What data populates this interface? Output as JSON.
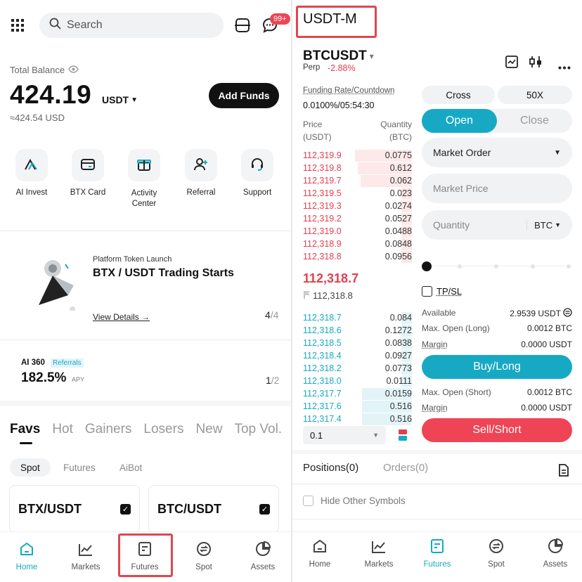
{
  "home": {
    "search": {
      "placeholder": "Search"
    },
    "notif_badge": "99+",
    "balance": {
      "label": "Total Balance",
      "value": "424.19",
      "currency": "USDT",
      "usd": "≈424.54 USD",
      "add_funds": "Add Funds"
    },
    "quick_actions": [
      {
        "label": "AI Invest",
        "icon": "ai-invest-icon"
      },
      {
        "label": "BTX Card",
        "icon": "card-icon"
      },
      {
        "label": "Activity Center",
        "icon": "gift-icon"
      },
      {
        "label": "Referral",
        "icon": "add-user-icon"
      },
      {
        "label": "Support",
        "icon": "headset-icon"
      }
    ],
    "promo": {
      "small": "Platform Token Launch",
      "title": "BTX / USDT Trading Starts",
      "link": "View Details →",
      "page": "4",
      "page_total": "/4"
    },
    "ai360": {
      "label": "AI 360",
      "badge": "Referrals",
      "value": "182.5%",
      "apy": "APY",
      "page": "1",
      "page_total": "/2"
    },
    "tabs": [
      "Favs",
      "Hot",
      "Gainers",
      "Losers",
      "New",
      "Top Vol."
    ],
    "subtabs": [
      "Spot",
      "Futures",
      "AiBot"
    ],
    "pairs": [
      "BTX/USDT",
      "BTC/USDT"
    ],
    "nav": [
      "Home",
      "Markets",
      "Futures",
      "Spot",
      "Assets"
    ]
  },
  "futures": {
    "market_type": "USDT-M",
    "symbol": "BTCUSDT",
    "symbol_arrow": "▾",
    "perp": "Perp",
    "change": "-2.88%",
    "funding_label": "Funding Rate/Countdown",
    "funding_value": "0.0100%/05:54:30",
    "orderbook": {
      "price_header": "Price",
      "price_unit": "(USDT)",
      "qty_header": "Quantity",
      "qty_unit": "(BTC)",
      "asks": [
        {
          "price": "112,319.9",
          "qty": "0.0775",
          "depth": 0.52
        },
        {
          "price": "112,319.8",
          "qty": "0.612",
          "depth": 0.5
        },
        {
          "price": "112,319.7",
          "qty": "0.062",
          "depth": 0.47
        },
        {
          "price": "112,319.5",
          "qty": "0.023",
          "depth": 0.1
        },
        {
          "price": "112,319.3",
          "qty": "0.0274",
          "depth": 0.1
        },
        {
          "price": "112,319.2",
          "qty": "0.0527",
          "depth": 0.1
        },
        {
          "price": "112,319.0",
          "qty": "0.0488",
          "depth": 0.1
        },
        {
          "price": "112,318.9",
          "qty": "0.0848",
          "depth": 0.1
        },
        {
          "price": "112,318.8",
          "qty": "0.0956",
          "depth": 0.1
        }
      ],
      "last_price": "112,318.7",
      "mark_price": "112,318.8",
      "bids": [
        {
          "price": "112,318.7",
          "qty": "0.084",
          "depth": 0.1
        },
        {
          "price": "112,318.6",
          "qty": "0.1272",
          "depth": 0.1
        },
        {
          "price": "112,318.5",
          "qty": "0.0838",
          "depth": 0.1
        },
        {
          "price": "112,318.4",
          "qty": "0.0927",
          "depth": 0.1
        },
        {
          "price": "112,318.2",
          "qty": "0.0773",
          "depth": 0.1
        },
        {
          "price": "112,318.0",
          "qty": "0.0111",
          "depth": 0.1
        },
        {
          "price": "112,317.7",
          "qty": "0.0159",
          "depth": 0.46
        },
        {
          "price": "112,317.6",
          "qty": "0.516",
          "depth": 0.46
        },
        {
          "price": "112,317.4",
          "qty": "0.516",
          "depth": 0.46
        }
      ],
      "depth_step": "0.1"
    },
    "margin_mode": "Cross",
    "leverage": "50X",
    "open_label": "Open",
    "close_label": "Close",
    "order_type": "Market Order",
    "market_price_placeholder": "Market Price",
    "quantity_placeholder": "Quantity",
    "quantity_unit": "BTC",
    "tpsl": "TP/SL",
    "available_label": "Available",
    "available_value": "2.9539 USDT",
    "max_open_long_label": "Max. Open (Long)",
    "max_open_long_value": "0.0012 BTC",
    "margin_label": "Margin",
    "margin_long_value": "0.0000 USDT",
    "buy_label": "Buy/Long",
    "max_open_short_label": "Max. Open (Short)",
    "max_open_short_value": "0.0012 BTC",
    "margin_short_value": "0.0000 USDT",
    "sell_label": "Sell/Short",
    "positions_tab": "Positions(0)",
    "orders_tab": "Orders(0)",
    "hide_other": "Hide Other Symbols",
    "nav": [
      "Home",
      "Markets",
      "Futures",
      "Spot",
      "Assets"
    ]
  },
  "colors": {
    "accent": "#17a9c4",
    "down": "#e2404f",
    "highlight": "#e0464f"
  }
}
